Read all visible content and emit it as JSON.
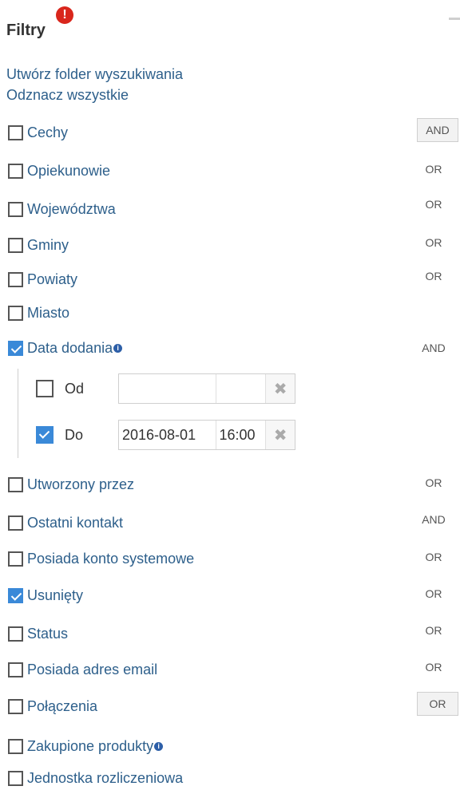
{
  "header": {
    "title": "Filtry",
    "alert_glyph": "!",
    "alert_color": "#d9261c"
  },
  "links": {
    "create_folder": "Utwórz folder wyszukiwania",
    "uncheck_all": "Odznacz wszystkie"
  },
  "filters": [
    {
      "label": "Cechy",
      "checked": false,
      "op": "AND",
      "op_button": true
    },
    {
      "label": "Opiekunowie",
      "checked": false,
      "op": "OR"
    },
    {
      "label": "Województwa",
      "checked": false,
      "op": "OR"
    },
    {
      "label": "Gminy",
      "checked": false,
      "op": "OR"
    },
    {
      "label": "Powiaty",
      "checked": false,
      "op": "OR"
    },
    {
      "label": "Miasto",
      "checked": false,
      "op": ""
    },
    {
      "label": "Data dodania",
      "checked": true,
      "op": "AND",
      "info": true
    },
    {
      "label": "Utworzony przez",
      "checked": false,
      "op": "OR"
    },
    {
      "label": "Ostatni kontakt",
      "checked": false,
      "op": "AND"
    },
    {
      "label": "Posiada konto systemowe",
      "checked": false,
      "op": "OR"
    },
    {
      "label": "Usunięty",
      "checked": true,
      "op": "OR"
    },
    {
      "label": "Status",
      "checked": false,
      "op": "OR"
    },
    {
      "label": "Posiada adres email",
      "checked": false,
      "op": "OR"
    },
    {
      "label": "Połączenia",
      "checked": false,
      "op": "OR",
      "op_button": true
    },
    {
      "label": "Zakupione produkty",
      "checked": false,
      "op": "",
      "info": true
    },
    {
      "label": "Jednostka rozliczeniowa",
      "checked": false,
      "op": ""
    }
  ],
  "date_range": {
    "from": {
      "label": "Od",
      "checked": false,
      "date": "",
      "time": ""
    },
    "to": {
      "label": "Do",
      "checked": true,
      "date": "2016-08-01",
      "time": "16:00"
    },
    "clear_glyph": "✖"
  },
  "info_glyph": "i"
}
